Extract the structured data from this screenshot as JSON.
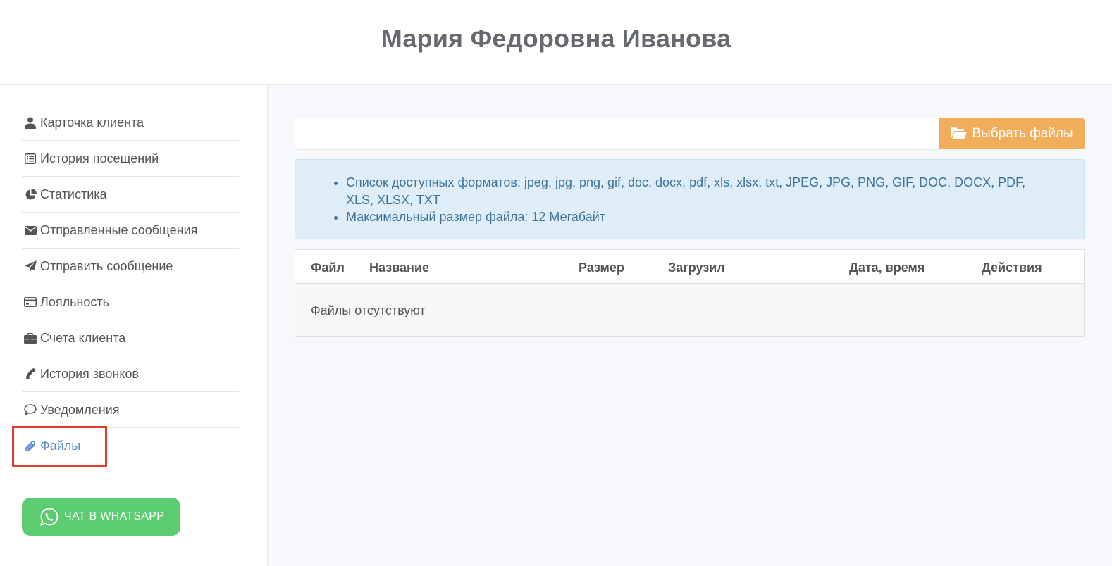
{
  "header": {
    "title": "Мария Федоровна Иванова"
  },
  "sidebar": {
    "items": [
      {
        "label": "Карточка клиента",
        "icon": "user-icon"
      },
      {
        "label": "История посещений",
        "icon": "list-icon"
      },
      {
        "label": "Статистика",
        "icon": "pie-chart-icon"
      },
      {
        "label": "Отправленные сообщения",
        "icon": "envelope-icon"
      },
      {
        "label": "Отправить сообщение",
        "icon": "paper-plane-icon"
      },
      {
        "label": "Лояльность",
        "icon": "credit-card-icon"
      },
      {
        "label": "Счета клиента",
        "icon": "briefcase-icon"
      },
      {
        "label": "История звонков",
        "icon": "phone-icon"
      },
      {
        "label": "Уведомления",
        "icon": "comment-icon"
      },
      {
        "label": "Файлы",
        "icon": "paperclip-icon",
        "active": true
      }
    ],
    "whatsapp_label": "ЧАТ В WHATSAPP"
  },
  "upload": {
    "input_value": "",
    "button_label": "Выбрать файлы"
  },
  "info": {
    "formats": "Список доступных форматов: jpeg, jpg, png, gif, doc, docx, pdf, xls, xlsx, txt, JPEG, JPG, PNG, GIF, DOC, DOCX, PDF, XLS, XLSX, TXT",
    "max_size": "Максимальный размер файла: 12 Мегабайт"
  },
  "table": {
    "columns": [
      "Файл",
      "Название",
      "Размер",
      "Загрузил",
      "Дата, время",
      "Действия"
    ],
    "empty_text": "Файлы отсутствуют"
  },
  "colors": {
    "active_link": "#5b8fc4",
    "highlight": "#e2402f",
    "whatsapp": "#5ccc70",
    "choose_button": "#f0ad5a",
    "info_bg": "#deedf7"
  }
}
